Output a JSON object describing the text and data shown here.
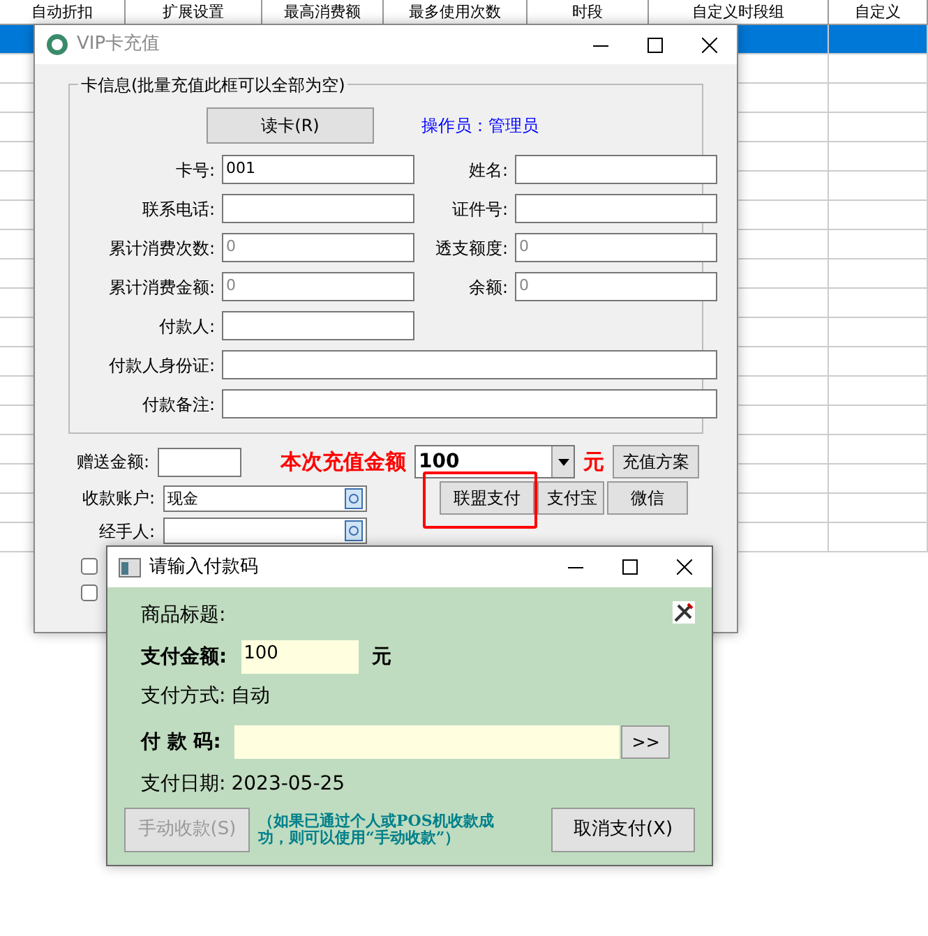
{
  "background_table": {
    "columns": [
      "自动折扣",
      "扩展设置",
      "最高消费额",
      "最多使用次数",
      "时段",
      "自定义时段组",
      "自定义"
    ],
    "rows": [
      {
        "selected": true
      },
      {
        "selected": false
      },
      {
        "selected": false
      },
      {
        "selected": false
      },
      {
        "selected": false
      },
      {
        "selected": false
      },
      {
        "selected": false
      },
      {
        "selected": false
      },
      {
        "selected": false
      },
      {
        "selected": false
      },
      {
        "selected": false
      },
      {
        "selected": false
      },
      {
        "selected": false
      },
      {
        "selected": false
      },
      {
        "selected": false
      },
      {
        "selected": false
      },
      {
        "selected": false
      },
      {
        "selected": false
      }
    ]
  },
  "vip_window": {
    "title": "VIP卡充值",
    "card_group": {
      "title": "卡信息(批量充值此框可以全部为空)",
      "read_button": "读卡(R)",
      "operator_label": "操作员：",
      "operator_value": "管理员",
      "fields": [
        {
          "label": "卡号:",
          "value": "001",
          "kind": "half"
        },
        {
          "label": "姓名:",
          "kind": "half"
        },
        {
          "label": "联系电话:",
          "kind": "half"
        },
        {
          "label": "证件号:",
          "kind": "half"
        },
        {
          "label": "累计消费次数:",
          "placeholder": "0",
          "kind": "half"
        },
        {
          "label": "透支额度:",
          "placeholder": "0",
          "kind": "half"
        },
        {
          "label": "累计消费金额:",
          "placeholder": "0",
          "kind": "half"
        },
        {
          "label": "余额:",
          "placeholder": "0",
          "kind": "half"
        },
        {
          "label": "付款人:",
          "kind": "single"
        },
        {
          "label": "付款人身份证:",
          "kind": "full"
        },
        {
          "label": "付款备注:",
          "kind": "full"
        }
      ]
    },
    "bonus": {
      "label": "赠送金额:"
    },
    "recharge": {
      "label": "本次充值金额",
      "value": "100",
      "unit": "元",
      "plan_button": "充值方案"
    },
    "account": {
      "label": "收款账户:",
      "value": "现金"
    },
    "handler": {
      "label": "经手人:"
    },
    "pay_buttons": [
      {
        "label": "联盟支付",
        "highlighted": true
      },
      {
        "label": "支付宝",
        "highlighted": false
      },
      {
        "label": "微信",
        "highlighted": false
      }
    ],
    "checkboxes": [
      {
        "checked": false
      },
      {
        "checked": false
      }
    ]
  },
  "pay_dialog": {
    "title": "请输入付款码",
    "product_label": "商品标题:",
    "amount_label": "支付金额:",
    "amount_value": "100",
    "amount_unit": "元",
    "method_label": "支付方式:",
    "method_value": "自动",
    "code_label": "付 款 码:",
    "go_button": ">>",
    "date_label": "支付日期:",
    "date_value": "2023-05-25",
    "manual_button": {
      "label": "手动收款(S)",
      "disabled": true
    },
    "hint": "（如果已通过个人或POS机收款成功，则可以使用“手动收款”）",
    "cancel_button": "取消支付(X)"
  }
}
